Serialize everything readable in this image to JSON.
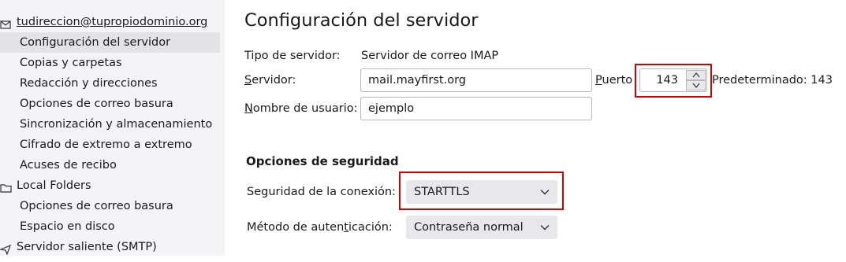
{
  "sidebar": {
    "items": [
      {
        "label": "tudireccion@tupropiodominio.org",
        "kind": "account",
        "icon": "mail-account-icon"
      },
      {
        "label": "Configuración del servidor",
        "kind": "child",
        "selected": true
      },
      {
        "label": "Copias y carpetas",
        "kind": "child"
      },
      {
        "label": "Redacción y direcciones",
        "kind": "child"
      },
      {
        "label": "Opciones de correo basura",
        "kind": "child"
      },
      {
        "label": "Sincronización y almacenamiento",
        "kind": "child"
      },
      {
        "label": "Cifrado de extremo a extremo",
        "kind": "child"
      },
      {
        "label": "Acuses de recibo",
        "kind": "child"
      },
      {
        "label": "Local Folders",
        "kind": "account",
        "icon": "folder-icon"
      },
      {
        "label": "Opciones de correo basura",
        "kind": "child"
      },
      {
        "label": "Espacio en disco",
        "kind": "child"
      },
      {
        "label": "Servidor saliente (SMTP)",
        "kind": "account",
        "icon": "outgoing-server-icon"
      }
    ]
  },
  "main": {
    "title": "Configuración del servidor",
    "server_type": {
      "label": "Tipo de servidor:",
      "value": "Servidor de correo IMAP"
    },
    "server": {
      "label_first": "S",
      "label_rest": "ervidor:",
      "value": "mail.mayfirst.org"
    },
    "port": {
      "label_first": "P",
      "label_rest": "uerto",
      "value": "143",
      "default_text": "Predeterminado: 143"
    },
    "username": {
      "label_first": "N",
      "label_rest": "ombre de usuario:",
      "value": "ejemplo"
    },
    "security_section": {
      "title": "Opciones de seguridad",
      "connection": {
        "label": "Seguridad de la conexión:",
        "value": "STARTTLS"
      },
      "auth": {
        "label_pre": "Método de auten",
        "label_u": "t",
        "label_post": "icación:",
        "value": "Contraseña normal"
      }
    }
  },
  "colors": {
    "highlight_box": "#d60000",
    "sidebar_bg": "#f4f4f6",
    "selected_bg": "#e3e3e6"
  }
}
